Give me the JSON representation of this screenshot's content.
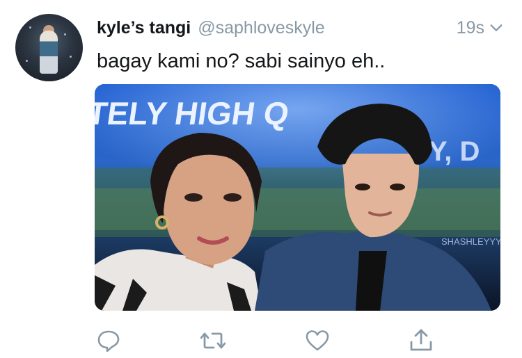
{
  "tweet": {
    "display_name": "kyle’s tangi",
    "handle": "@saphloveskyle",
    "timestamp": "19s",
    "text": "bagay kami no? sabi sainyo eh..",
    "media": {
      "banner_text": "TELY HIGH Q",
      "banner_suffix": "Y, D",
      "watermark": "SHASHLEYYY"
    }
  },
  "icons": {
    "menu": "chevron-down-icon",
    "reply": "reply-icon",
    "retweet": "retweet-icon",
    "like": "heart-icon",
    "share": "share-icon"
  },
  "colors": {
    "text": "#14171a",
    "secondary": "#8899a6"
  }
}
